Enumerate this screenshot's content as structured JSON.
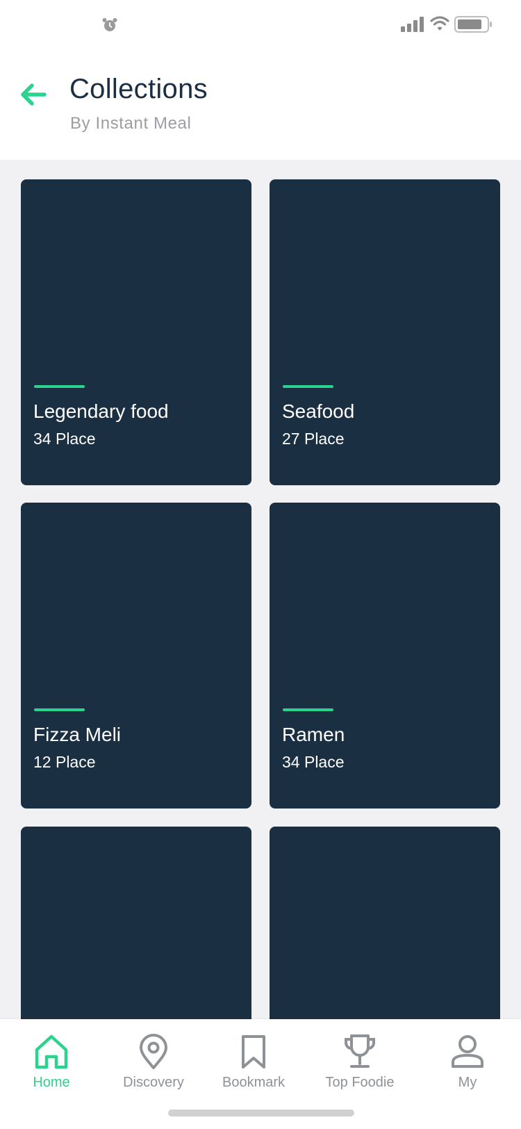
{
  "header": {
    "title": "Collections",
    "subtitle": "By Instant Meal"
  },
  "collections": [
    {
      "title": "Legendary food",
      "count": "34 Place"
    },
    {
      "title": "Seafood",
      "count": "27 Place"
    },
    {
      "title": "Fizza Meli",
      "count": "12 Place"
    },
    {
      "title": "Ramen",
      "count": "34 Place"
    },
    {
      "title": "",
      "count": ""
    },
    {
      "title": "",
      "count": ""
    }
  ],
  "nav": {
    "items": [
      {
        "label": "Home",
        "icon": "home-icon",
        "active": true
      },
      {
        "label": "Discovery",
        "icon": "location-pin-icon",
        "active": false
      },
      {
        "label": "Bookmark",
        "icon": "bookmark-icon",
        "active": false
      },
      {
        "label": "Top Foodie",
        "icon": "trophy-icon",
        "active": false
      },
      {
        "label": "My",
        "icon": "user-icon",
        "active": false
      }
    ]
  },
  "colors": {
    "accent": "#2bd38f",
    "card_bg": "#1b2f42",
    "page_bg": "#f1f1f3",
    "title": "#1b2f42",
    "muted": "#8e9297"
  },
  "status_bar": {
    "icons": [
      "alarm-icon",
      "signal-icon",
      "wifi-icon",
      "battery-icon"
    ]
  }
}
